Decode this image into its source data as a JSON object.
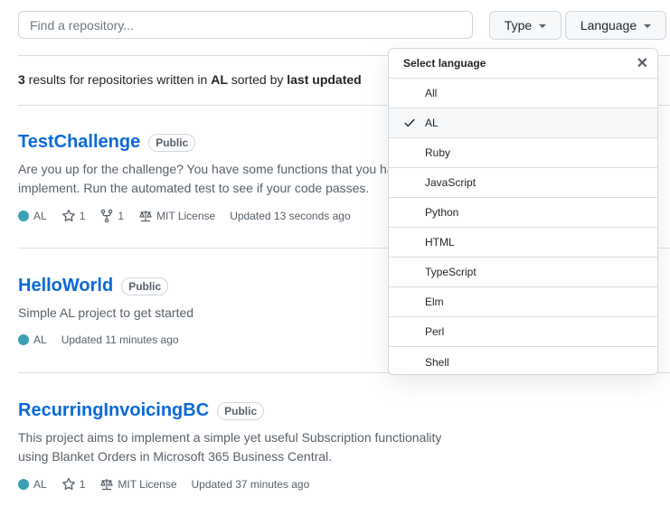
{
  "search": {
    "placeholder": "Find a repository..."
  },
  "filters": {
    "type_label": "Type",
    "language_label": "Language"
  },
  "summary": {
    "count": "3",
    "text1": " results for repositories written in ",
    "language": "AL",
    "text2": " sorted by ",
    "sort": "last updated"
  },
  "repos": [
    {
      "name": "TestChallenge",
      "visibility": "Public",
      "description": "Are you up for the challenge? You have some functions that you have to implement. Run the automated test to see if your code passes.",
      "language": "AL",
      "language_color": "#3aa0b2",
      "stars": "1",
      "forks": "1",
      "license": "MIT License",
      "updated": "Updated 13 seconds ago"
    },
    {
      "name": "HelloWorld",
      "visibility": "Public",
      "description": "Simple AL project to get started",
      "language": "AL",
      "language_color": "#3aa0b2",
      "updated": "Updated 11 minutes ago"
    },
    {
      "name": "RecurringInvoicingBC",
      "visibility": "Public",
      "description": "This project aims to implement a simple yet useful Subscription functionality using Blanket Orders in Microsoft 365 Business Central.",
      "language": "AL",
      "language_color": "#3aa0b2",
      "stars": "1",
      "license": "MIT License",
      "updated": "Updated 37 minutes ago"
    }
  ],
  "language_menu": {
    "title": "Select language",
    "close_icon": "close-icon",
    "selected": "AL",
    "items": [
      "All",
      "AL",
      "Ruby",
      "JavaScript",
      "Python",
      "HTML",
      "TypeScript",
      "Elm",
      "Perl",
      "Shell"
    ]
  }
}
